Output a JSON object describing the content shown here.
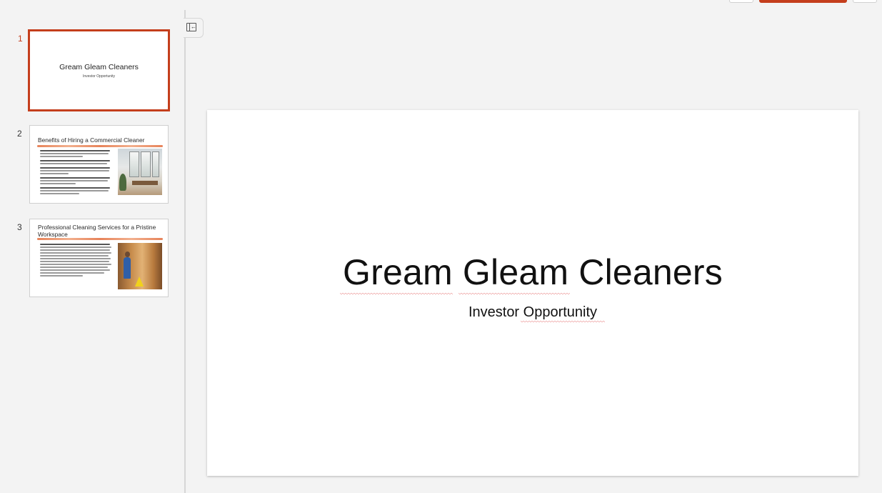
{
  "thumbnails": [
    {
      "number": "1",
      "title": "Gream Gleam Cleaners",
      "subtitle": "Investor Opportunity"
    },
    {
      "number": "2",
      "title": "Benefits of Hiring a Commercial Cleaner"
    },
    {
      "number": "3",
      "title": "Professional Cleaning Services for a Pristine Workspace"
    }
  ],
  "slide": {
    "title": "Gream Gleam Cleaners",
    "subtitle": "Investor Opportunity"
  },
  "colors": {
    "accent": "#c43e1c",
    "underline": "#e7835a"
  },
  "icons": {
    "collapse": "collapse-panel-icon"
  }
}
